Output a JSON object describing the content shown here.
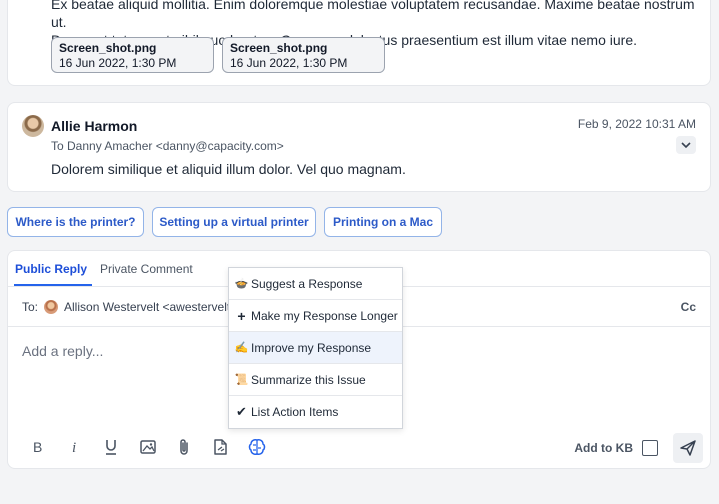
{
  "message1": {
    "body_line1": "Ex beatae aliquid mollitia. Enim doloremque molestiae voluptatem recusandae. Maxime beatae nostrum ut.",
    "body_line2": "Deserunt totam aut nihil quo beatae. Quas non delectus praesentium est illum vitae nemo iure.",
    "attachments": [
      {
        "name": "Screen_shot.png",
        "date": "16 Jun 2022, 1:30 PM"
      },
      {
        "name": "Screen_shot.png",
        "date": "16 Jun 2022, 1:30 PM"
      }
    ]
  },
  "message2": {
    "sender": "Allie Harmon",
    "to": "To Danny Amacher <danny@capacity.com>",
    "timestamp": "Feb 9, 2022 10:31 AM",
    "body": "Dolorem similique et aliquid illum dolor. Vel quo magnam."
  },
  "suggestions": [
    "Where is the printer?",
    "Setting up a virtual printer",
    "Printing on a Mac"
  ],
  "composer": {
    "tabs": [
      "Public Reply",
      "Private Comment"
    ],
    "to_label": "To:",
    "recipient": "Allison Westervelt <awestervelt@",
    "cc_label": "Cc",
    "reply_placeholder": "Add a reply...",
    "add_to_kb_label": "Add to KB",
    "toolbar_icons": [
      "bold-icon",
      "italic-icon",
      "underline-icon",
      "image-icon",
      "attachment-icon",
      "document-icon",
      "ai-brain-icon"
    ]
  },
  "ai_menu": {
    "items": [
      {
        "icon": "🍲",
        "label": "Suggest a Response"
      },
      {
        "icon": "+",
        "label": "Make my Response Longer"
      },
      {
        "icon": "✍",
        "label": "Improve my Response"
      },
      {
        "icon": "📜",
        "label": "Summarize this Issue"
      },
      {
        "icon": "✔",
        "label": "List Action Items"
      }
    ],
    "highlighted_index": 2
  },
  "colors": {
    "accent": "#2563eb",
    "chip_text": "#2c5ac8",
    "chip_border": "#93b4e8"
  }
}
